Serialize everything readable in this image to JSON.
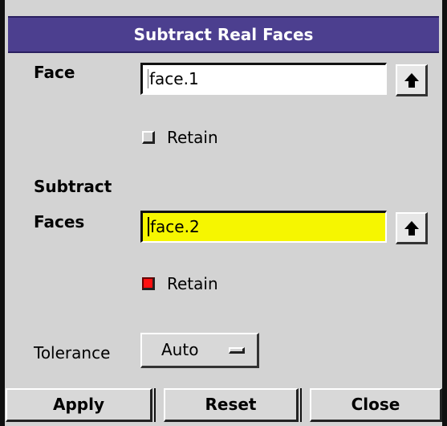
{
  "dialog": {
    "title": "Subtract Real Faces"
  },
  "face": {
    "label": "Face",
    "value": "face.1",
    "retain_label": "Retain",
    "retain_checked": false
  },
  "subtract": {
    "label_line1": "Subtract",
    "label_line2": "Faces",
    "value": "face.2",
    "retain_label": "Retain",
    "retain_checked": true
  },
  "tolerance": {
    "label": "Tolerance",
    "selected": "Auto"
  },
  "buttons": {
    "apply": "Apply",
    "reset": "Reset",
    "close": "Close"
  },
  "colors": {
    "title_bg": "#4c3f8f",
    "active_field_bg": "#f6f600",
    "checked_box": "#ff1010"
  },
  "icons": {
    "face_list_button": "up-arrow-icon",
    "subtract_list_button": "up-arrow-icon"
  }
}
